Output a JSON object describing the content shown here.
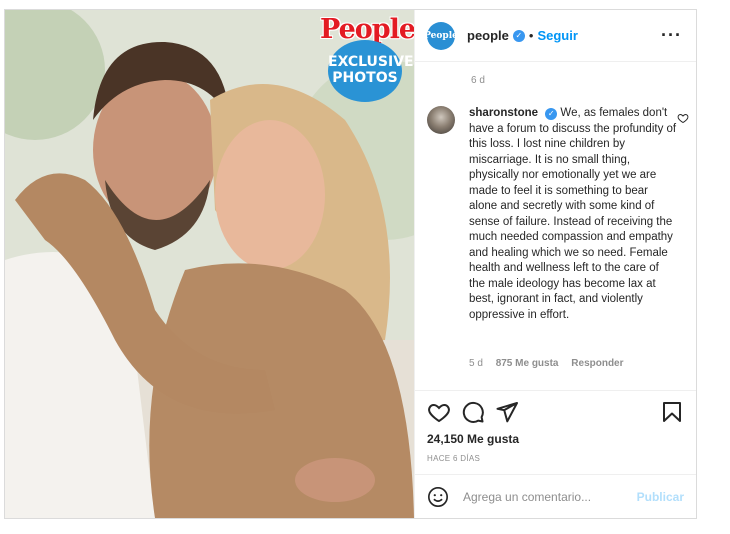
{
  "photo": {
    "badge_brand": "People",
    "badge_line1": "EXCLUSIVE",
    "badge_line2": "PHOTOS"
  },
  "header": {
    "avatar_text": "People",
    "username": "people",
    "separator": "•",
    "follow_label": "Seguir",
    "more_icon": "more-horizontal-icon"
  },
  "comments": {
    "top_time": "6 d",
    "items": [
      {
        "user": "sharonstone",
        "text": "We, as females don't have a forum to discuss the profundity of this loss. I lost nine children by miscarriage. It is no small thing, physically nor emotionally yet we are made to feel it is something to bear alone and secretly with some kind of sense of failure. Instead of receiving the much needed compassion and empathy and healing which we so need. Female health and wellness left to the care of the male ideology has become lax at best, ignorant in fact, and violently oppressive in effort.",
        "time": "5 d",
        "likes": "875 Me gusta",
        "reply_label": "Responder"
      }
    ]
  },
  "actions": {
    "like_icon": "heart-icon",
    "comment_icon": "comment-icon",
    "share_icon": "share-icon",
    "save_icon": "bookmark-icon"
  },
  "likes_text": "24,150 Me gusta",
  "date_text": "HACE 6 DÍAS",
  "add_comment": {
    "placeholder": "Agrega un comentario...",
    "publish_label": "Publicar"
  },
  "colors": {
    "accent": "#0095f6",
    "publish_disabled": "#b2dffc",
    "verified": "#3897f0",
    "muted": "#8e8e8e",
    "people_red": "#e31b23",
    "people_blue": "#2a93d5"
  }
}
